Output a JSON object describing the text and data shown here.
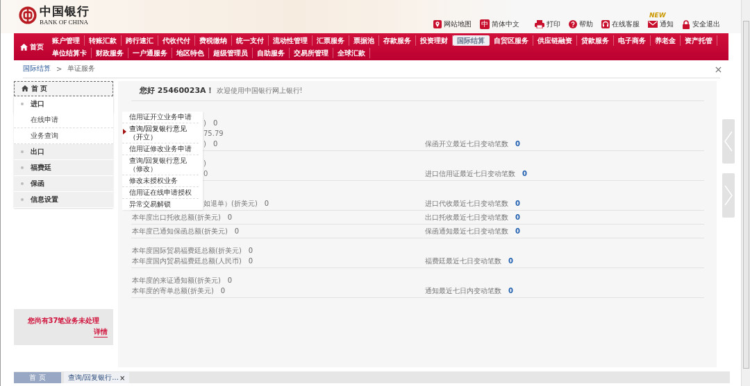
{
  "header": {
    "logo_cn": "中国银行",
    "logo_en": "BANK OF CHINA",
    "links": [
      {
        "label": "网站地图"
      },
      {
        "glyph": "中",
        "label": "简体中文"
      },
      {
        "label": "打印"
      },
      {
        "label": "帮助"
      },
      {
        "label": "在线客服"
      },
      {
        "label": "通知",
        "badge": "NEW"
      },
      {
        "label": "安全退出"
      }
    ]
  },
  "nav": {
    "home": "首页",
    "rows": [
      [
        {
          "label": "账户管理",
          "selected": false
        },
        {
          "label": "转账汇款",
          "selected": false
        },
        {
          "label": "跨行速汇",
          "selected": false
        },
        {
          "label": "代收代付",
          "selected": false
        },
        {
          "label": "费税缴纳",
          "selected": false
        },
        {
          "label": "统一支付",
          "selected": false
        },
        {
          "label": "流动性管理",
          "selected": false
        },
        {
          "label": "汇票服务",
          "selected": false
        },
        {
          "label": "票据池",
          "selected": false
        },
        {
          "label": "存款服务",
          "selected": false
        },
        {
          "label": "投资理财",
          "selected": false
        },
        {
          "label": "国际结算",
          "selected": true
        },
        {
          "label": "自贸区服务",
          "selected": false
        },
        {
          "label": "供应链融资",
          "selected": false
        },
        {
          "label": "贷款服务",
          "selected": false
        },
        {
          "label": "电子商务",
          "selected": false
        },
        {
          "label": "养老金",
          "selected": false
        },
        {
          "label": "资产托管",
          "selected": false
        }
      ],
      [
        {
          "label": "单位结算卡",
          "selected": false
        },
        {
          "label": "财政服务",
          "selected": false
        },
        {
          "label": "一户通服务",
          "selected": false
        },
        {
          "label": "地区特色",
          "selected": false
        },
        {
          "label": "超级管理员",
          "selected": false
        },
        {
          "label": "自助服务",
          "selected": false
        },
        {
          "label": "交易所管理",
          "selected": false
        },
        {
          "label": "全球汇款",
          "selected": false
        }
      ]
    ]
  },
  "breadcrumb": {
    "items": [
      "国际结算",
      "单证服务"
    ],
    "separator": ">"
  },
  "sidebar": {
    "home": "首 页",
    "items": [
      {
        "label": "进口",
        "expanded": true,
        "children": [
          {
            "label": "在线申请"
          },
          {
            "label": "业务查询"
          }
        ]
      },
      {
        "label": "出口",
        "expanded": false
      },
      {
        "label": "福费廷",
        "expanded": false
      },
      {
        "label": "保函",
        "expanded": false
      },
      {
        "label": "信息设置",
        "expanded": false
      }
    ],
    "notice": "您尚有**37**笔业务未处理",
    "notice_link": "详情"
  },
  "popup": {
    "items": [
      {
        "label": "信用证开立业务申请",
        "selected": false
      },
      {
        "label": "查询/回复银行意见（开立）",
        "selected": true
      },
      {
        "label": "信用证修改业务申请",
        "selected": false
      },
      {
        "label": "查询/回复银行意见（修改）",
        "selected": false
      },
      {
        "label": "修改未授权业务",
        "selected": false
      },
      {
        "label": "信用证在线申请授权",
        "selected": false
      },
      {
        "label": "异常交易解锁",
        "selected": false
      }
    ]
  },
  "greeting": {
    "title": "您好 25460023A！",
    "subtitle": "欢迎使用中国银行网上银行!"
  },
  "sections": [
    {
      "lines": [
        {
          "kind": "clipped",
          "text": ")",
          "value": "0"
        },
        {
          "kind": "clipped",
          "text": "75.79"
        },
        {
          "kind": "clipped",
          "text": ")",
          "value": "0"
        }
      ],
      "recent": {
        "label": "保函开立最近七日变动笔数",
        "value": "0"
      }
    },
    {
      "lines": [
        {
          "kind": "clipped",
          "text": ")"
        },
        {
          "kind": "clipped",
          "text": "0"
        }
      ],
      "recent": {
        "label": "进口信用证最近七日变动笔数",
        "value": "0"
      }
    },
    {
      "lines": [
        {
          "kind": "clipped",
          "text": "如退单）(折美元)",
          "value": "0"
        }
      ],
      "recent": {
        "label": "进口代收最近七日变动笔数",
        "value": "0"
      }
    },
    {
      "lines": [
        {
          "kind": "full",
          "text": "本年度出口托收总额(折美元)",
          "value": "0"
        }
      ],
      "recent": {
        "label": "出口托收最近七日变动笔数",
        "value": "0"
      }
    },
    {
      "lines": [
        {
          "kind": "full",
          "text": "本年度已通知保函总额(折美元)",
          "value": "0"
        }
      ],
      "recent": {
        "label": "保函通知最近七日变动笔数",
        "value": "0"
      }
    },
    {
      "lines": [
        {
          "kind": "full",
          "text": "本年度国际贸易福费廷总额(折美元)",
          "value": "0"
        },
        {
          "kind": "full",
          "text": "本年度国内贸易福费廷总额(人民币)",
          "value": "0"
        }
      ],
      "recent": {
        "label": "福费廷最近七日变动笔数",
        "value": "0"
      }
    },
    {
      "lines": [
        {
          "kind": "full",
          "text": "本年度的来证通知额(折美元)",
          "value": "0"
        },
        {
          "kind": "full",
          "text": "本年度的寄单总额(折美元)",
          "value": "0"
        }
      ],
      "recent": {
        "label": "通知最近七日内变动笔数",
        "value": "0"
      }
    }
  ],
  "bottom_tabs": [
    {
      "label": "首 页",
      "selected": true
    },
    {
      "label": "查询/回复银行...",
      "selected": false,
      "close": "×"
    }
  ]
}
